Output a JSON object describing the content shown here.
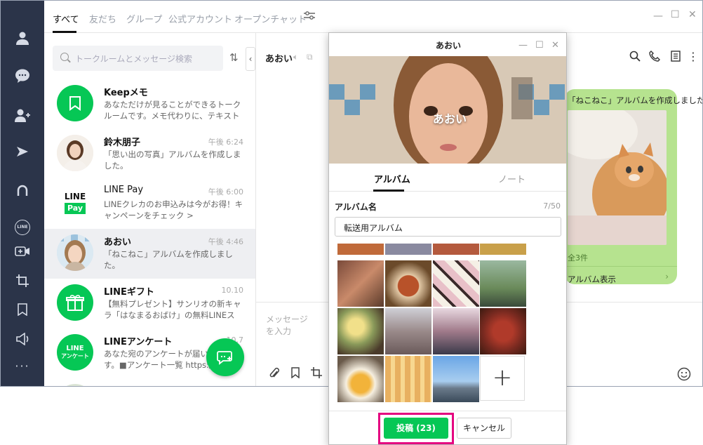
{
  "tabs": [
    "すべて",
    "友だち",
    "グループ",
    "公式アカウント",
    "オープンチャット"
  ],
  "search": {
    "placeholder": "トークルームとメッセージ検索"
  },
  "chats": [
    {
      "name": "Keepメモ",
      "time": "",
      "msg": "あなただけが見ることができるトークルームです。メモ代わりに、テキストや写真、動..."
    },
    {
      "name": "鈴木朋子",
      "time": "午後 6:24",
      "msg": "「思い出の写真」アルバムを作成しました。"
    },
    {
      "name": "LINE Pay",
      "time": "午後 6:00",
      "msg": "LINEクレカのお申込みは今がお得！キャンペーンをチェック >"
    },
    {
      "name": "あおい",
      "time": "午後 4:46",
      "msg": "「ねこねこ」アルバムを作成しました。"
    },
    {
      "name": "LINEギフト",
      "time": "10.10",
      "msg": "【無料プレゼント】サンリオの新キャラ「はなまるおばけ」の無料LINEスタ..."
    },
    {
      "name": "LINEアンケート",
      "time": "10.7",
      "msg": "あなた宛のアンケートが届いています。■アンケート一覧 https://line..."
    }
  ],
  "icons": {
    "line_pay_logo": [
      "LINE",
      "Pay"
    ],
    "line_survey_logo": [
      "LINE",
      "アンケート"
    ],
    "rail_line_badge": "LINE"
  },
  "chat": {
    "partner": "あおい",
    "message_text": "「ねこねこ」アルバムを作成しました。",
    "album_count": "全3件",
    "album_view": "アルバム表示",
    "composer_placeholder": "メッセージを入力"
  },
  "dialog": {
    "title": "あおい",
    "profile_name": "あおい",
    "tab_album": "アルバム",
    "tab_note": "ノート",
    "album_name_label": "アルバム名",
    "char_count": "7/50",
    "album_name_value": "転送用アルバム",
    "post_label": "投稿 (23)",
    "cancel_label": "キャンセル"
  },
  "colors": {
    "accent": "#06c755",
    "rail": "#2b3449",
    "highlight": "#e4007f",
    "bubble": "#b6e38f"
  }
}
